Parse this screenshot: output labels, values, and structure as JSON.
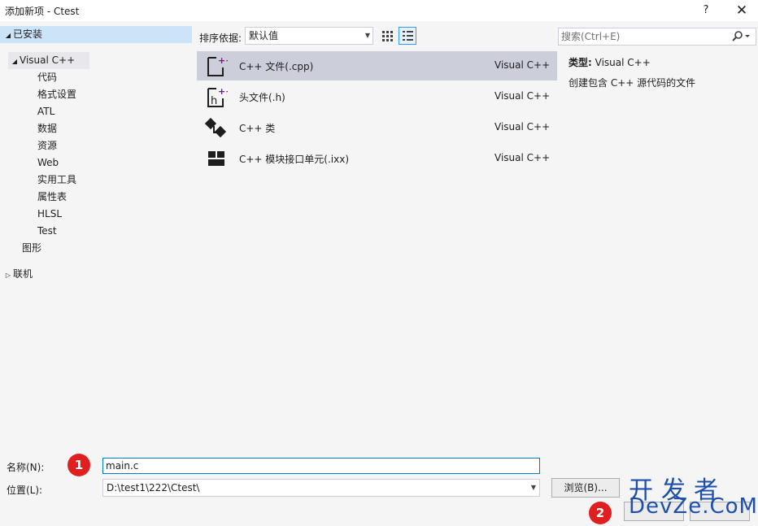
{
  "window": {
    "title": "添加新项 - Ctest",
    "help_label": "?",
    "close_label": "✕"
  },
  "tree": {
    "installed": {
      "label": "已安装",
      "expanded": true
    },
    "visual_cpp": {
      "label": "Visual C++",
      "expanded": true
    },
    "children": [
      "代码",
      "格式设置",
      "ATL",
      "数据",
      "资源",
      "Web",
      "实用工具",
      "属性表",
      "HLSL",
      "Test"
    ],
    "graphics": "图形",
    "online": {
      "label": "联机",
      "expanded": false
    }
  },
  "toolbar": {
    "sort_label": "排序依据:",
    "sort_value": "默认值",
    "grid_view_icon": "grid-view-icon",
    "list_view_icon": "list-view-icon"
  },
  "templates": [
    {
      "name": "C++ 文件(.cpp)",
      "lang": "Visual C++",
      "icon": "cpp-file-icon",
      "selected": true
    },
    {
      "name": "头文件(.h)",
      "lang": "Visual C++",
      "icon": "header-file-icon",
      "selected": false
    },
    {
      "name": "C++ 类",
      "lang": "Visual C++",
      "icon": "class-icon",
      "selected": false
    },
    {
      "name": "C++ 模块接口单元(.ixx)",
      "lang": "Visual C++",
      "icon": "module-icon",
      "selected": false
    }
  ],
  "search": {
    "placeholder": "搜索(Ctrl+E)"
  },
  "details": {
    "type_key": "类型:",
    "type_value": "Visual C++",
    "description": "创建包含 C++ 源代码的文件"
  },
  "form": {
    "name_label": "名称(N):",
    "name_value": "main.c",
    "location_label": "位置(L):",
    "location_value": "D:\\test1\\222\\Ctest\\",
    "browse_label": "浏览(B)..."
  },
  "annotations": {
    "badge1": "1",
    "badge2": "2"
  },
  "watermark": {
    "cn": "开发者",
    "en": "DevZe.CoM"
  },
  "colors": {
    "accent": "#007acc",
    "selection": "#cce4f7",
    "template_selected": "#ccceda",
    "badge": "#e02020",
    "icon_purple": "#68217a",
    "watermark": "#1f4fae"
  }
}
